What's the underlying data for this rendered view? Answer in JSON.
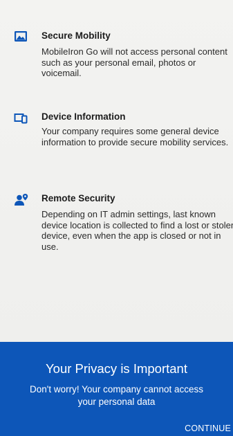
{
  "colors": {
    "background": "#f1f1ef",
    "accent": "#0d56b8",
    "icon": "#0d56b8",
    "text": "#222222",
    "footer_text": "#ffffff"
  },
  "sections": [
    {
      "icon": "image-icon",
      "title": "Secure Mobility",
      "description": "MobileIron Go will not access personal content such as your personal email, photos or voicemail."
    },
    {
      "icon": "devices-icon",
      "title": "Device Information",
      "description": "Your company requires some general device information to provide secure mobility services."
    },
    {
      "icon": "person-location-icon",
      "title": "Remote Security",
      "description": "Depending on IT admin settings, last known device location is collected to find a lost or stolen device, even when the app is closed or not in use."
    }
  ],
  "footer": {
    "heading": "Your Privacy is Important",
    "subtext": "Don't worry! Your company cannot access your personal data",
    "continue_label": "CONTINUE"
  }
}
